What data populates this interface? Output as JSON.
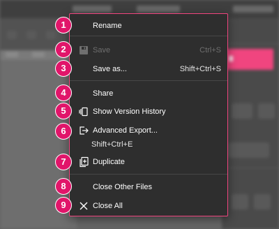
{
  "menu": {
    "items": [
      {
        "label": "Rename",
        "shortcut": "",
        "icon": "",
        "disabled": false
      },
      {
        "label": "Save",
        "shortcut": "Ctrl+S",
        "icon": "save-icon",
        "disabled": true
      },
      {
        "label": "Save as...",
        "shortcut": "Shift+Ctrl+S",
        "icon": "",
        "disabled": false
      },
      {
        "label": "Share",
        "shortcut": "",
        "icon": "",
        "disabled": false
      },
      {
        "label": "Show Version History",
        "shortcut": "",
        "icon": "version-history-icon",
        "disabled": false
      },
      {
        "label": "Advanced Export...",
        "shortcut": "Shift+Ctrl+E",
        "icon": "export-icon",
        "disabled": false
      },
      {
        "label": "Duplicate",
        "shortcut": "",
        "icon": "duplicate-icon",
        "disabled": false
      },
      {
        "label": "Close Other Files",
        "shortcut": "",
        "icon": "",
        "disabled": false
      },
      {
        "label": "Close All",
        "shortcut": "",
        "icon": "close-icon",
        "disabled": false
      }
    ]
  },
  "badges": [
    "1",
    "2",
    "3",
    "4",
    "5",
    "6",
    "7",
    "8",
    "9"
  ],
  "colors": {
    "badge": "#e1156a",
    "menu_border": "#f0457f",
    "menu_background": "#2e2e2e",
    "accent": "#f0457f"
  }
}
